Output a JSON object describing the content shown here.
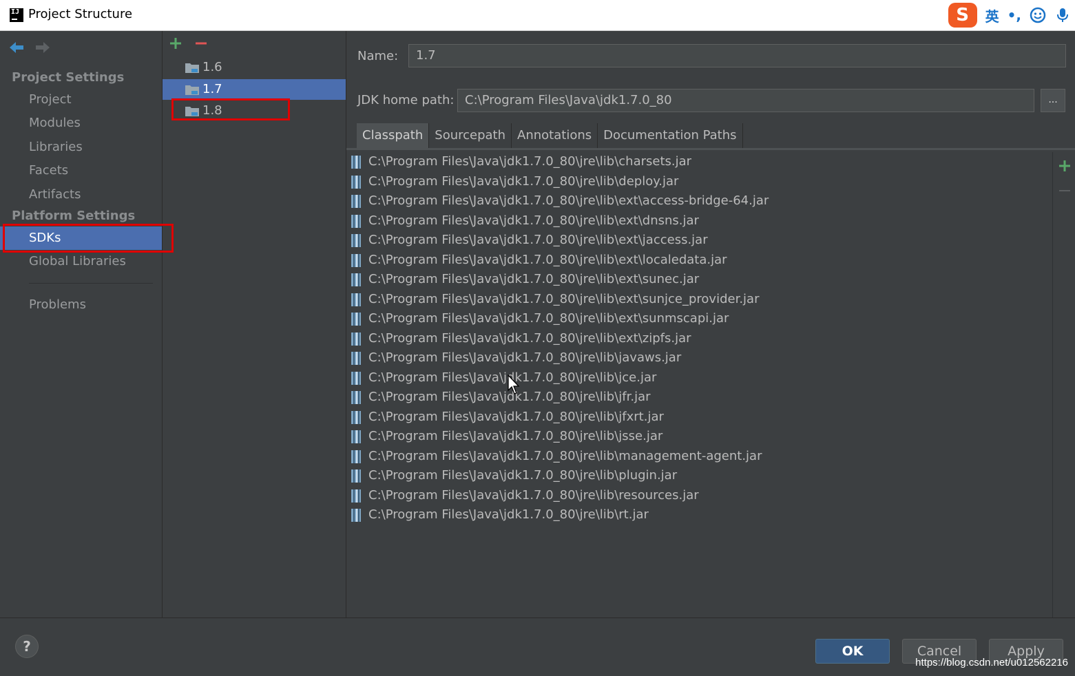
{
  "window": {
    "title": "Project Structure"
  },
  "ime": {
    "logo": "S",
    "lang": "英",
    "punct": "•,"
  },
  "sidebar": {
    "project_settings_header": "Project Settings",
    "project_items": [
      "Project",
      "Modules",
      "Libraries",
      "Facets",
      "Artifacts"
    ],
    "platform_settings_header": "Platform Settings",
    "platform_items": [
      "SDKs",
      "Global Libraries"
    ],
    "other_items": [
      "Problems"
    ],
    "selected": "SDKs"
  },
  "sdks": {
    "items": [
      "1.6",
      "1.7",
      "1.8"
    ],
    "selected": "1.7"
  },
  "detail": {
    "name_label": "Name:",
    "name_value": "1.7",
    "jdk_label": "JDK home path:",
    "jdk_value": "C:\\Program Files\\Java\\jdk1.7.0_80",
    "browse_label": "...",
    "tabs": [
      "Classpath",
      "Sourcepath",
      "Annotations",
      "Documentation Paths"
    ],
    "active_tab": "Classpath",
    "classpath": [
      "C:\\Program Files\\Java\\jdk1.7.0_80\\jre\\lib\\charsets.jar",
      "C:\\Program Files\\Java\\jdk1.7.0_80\\jre\\lib\\deploy.jar",
      "C:\\Program Files\\Java\\jdk1.7.0_80\\jre\\lib\\ext\\access-bridge-64.jar",
      "C:\\Program Files\\Java\\jdk1.7.0_80\\jre\\lib\\ext\\dnsns.jar",
      "C:\\Program Files\\Java\\jdk1.7.0_80\\jre\\lib\\ext\\jaccess.jar",
      "C:\\Program Files\\Java\\jdk1.7.0_80\\jre\\lib\\ext\\localedata.jar",
      "C:\\Program Files\\Java\\jdk1.7.0_80\\jre\\lib\\ext\\sunec.jar",
      "C:\\Program Files\\Java\\jdk1.7.0_80\\jre\\lib\\ext\\sunjce_provider.jar",
      "C:\\Program Files\\Java\\jdk1.7.0_80\\jre\\lib\\ext\\sunmscapi.jar",
      "C:\\Program Files\\Java\\jdk1.7.0_80\\jre\\lib\\ext\\zipfs.jar",
      "C:\\Program Files\\Java\\jdk1.7.0_80\\jre\\lib\\javaws.jar",
      "C:\\Program Files\\Java\\jdk1.7.0_80\\jre\\lib\\jce.jar",
      "C:\\Program Files\\Java\\jdk1.7.0_80\\jre\\lib\\jfr.jar",
      "C:\\Program Files\\Java\\jdk1.7.0_80\\jre\\lib\\jfxrt.jar",
      "C:\\Program Files\\Java\\jdk1.7.0_80\\jre\\lib\\jsse.jar",
      "C:\\Program Files\\Java\\jdk1.7.0_80\\jre\\lib\\management-agent.jar",
      "C:\\Program Files\\Java\\jdk1.7.0_80\\jre\\lib\\plugin.jar",
      "C:\\Program Files\\Java\\jdk1.7.0_80\\jre\\lib\\resources.jar",
      "C:\\Program Files\\Java\\jdk1.7.0_80\\jre\\lib\\rt.jar"
    ]
  },
  "footer": {
    "help": "?",
    "ok": "OK",
    "cancel": "Cancel",
    "apply": "Apply",
    "watermark": "https://blog.csdn.net/u012562216"
  },
  "colors": {
    "background": "#3c3f41",
    "selection": "#4b6eaf",
    "highlight_box": "#e00000",
    "add_green": "#59a869",
    "remove_red": "#e05555"
  }
}
